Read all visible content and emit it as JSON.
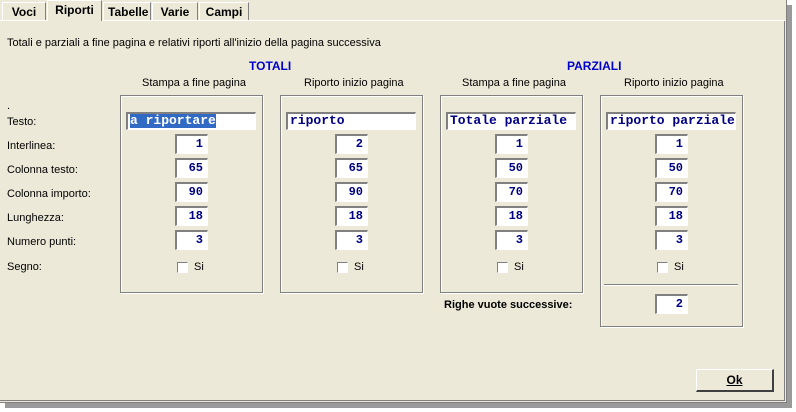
{
  "tabs": [
    {
      "label": "Voci"
    },
    {
      "label": "Riporti"
    },
    {
      "label": "Tabelle"
    },
    {
      "label": "Varie"
    },
    {
      "label": "Campi"
    }
  ],
  "description": "Totali e parziali a fine pagina e relativi riporti all'inizio della pagina successiva",
  "sections": {
    "totali": "TOTALI",
    "parziali": "PARZIALI"
  },
  "column_headers": {
    "stampa": "Stampa a fine pagina",
    "riporto": "Riporto inizio pagina"
  },
  "row_labels": {
    "dot": ".",
    "testo": "Testo:",
    "interlinea": "Interlinea:",
    "colonna_testo": "Colonna testo:",
    "colonna_importo": "Colonna importo:",
    "lunghezza": "Lunghezza:",
    "numero_punti": "Numero punti:",
    "segno": "Segno:"
  },
  "groups": [
    {
      "testo": "a riportare",
      "interlinea": "1",
      "colonna_testo": "65",
      "colonna_importo": "90",
      "lunghezza": "18",
      "numero_punti": "3",
      "segno_label": "Si"
    },
    {
      "testo": "riporto",
      "interlinea": "2",
      "colonna_testo": "65",
      "colonna_importo": "90",
      "lunghezza": "18",
      "numero_punti": "3",
      "segno_label": "Si"
    },
    {
      "testo": "Totale parziale",
      "interlinea": "1",
      "colonna_testo": "50",
      "colonna_importo": "70",
      "lunghezza": "18",
      "numero_punti": "3",
      "segno_label": "Si"
    },
    {
      "testo": "riporto parziale",
      "interlinea": "1",
      "colonna_testo": "50",
      "colonna_importo": "70",
      "lunghezza": "18",
      "numero_punti": "3",
      "segno_label": "Si"
    }
  ],
  "righe_vuote": {
    "label": "Righe vuote successive:",
    "value": "2"
  },
  "ok_button": "Ok",
  "colors": {
    "accent": "#0000cc",
    "field_text": "#000080",
    "selection": "#316ac5",
    "background": "#ece9d8"
  }
}
